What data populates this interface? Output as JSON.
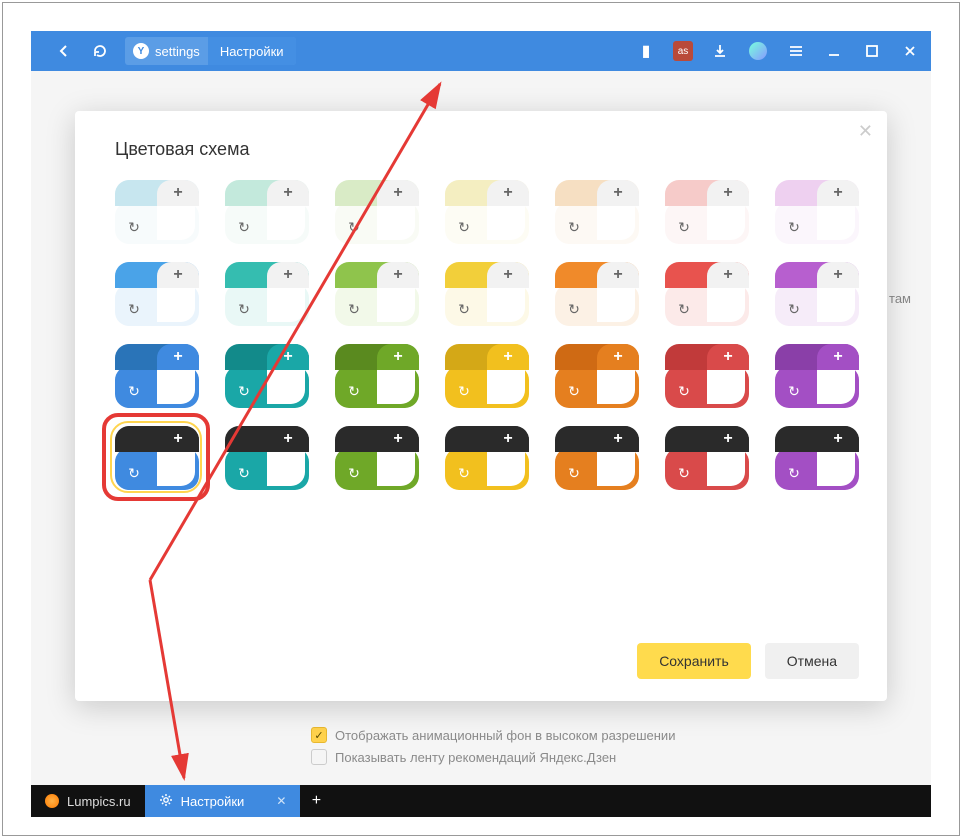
{
  "titlebar": {
    "addr_text": "settings",
    "page_title": "Настройки"
  },
  "modal": {
    "title": "Цветовая схема",
    "save_label": "Сохранить",
    "cancel_label": "Отмена"
  },
  "hidden": {
    "right_text": "там",
    "check1": "Отображать анимационный фон в высоком разрешении",
    "check2": "Показывать ленту рекомендаций Яндекс.Дзен"
  },
  "taskbar": {
    "item1": "Lumpics.ru",
    "item2": "Настройки"
  },
  "colors": {
    "row1": [
      {
        "top": "#c7e6ef",
        "tab": "#f2f2f2",
        "main": "#f7fbfc",
        "dark": false
      },
      {
        "top": "#c3e9dc",
        "tab": "#f2f2f2",
        "main": "#f6fbf9",
        "dark": false
      },
      {
        "top": "#d9ebc6",
        "tab": "#f2f2f2",
        "main": "#f9fbf5",
        "dark": false
      },
      {
        "top": "#f4eec1",
        "tab": "#f2f2f2",
        "main": "#fdfcf4",
        "dark": false
      },
      {
        "top": "#f6dfc2",
        "tab": "#f2f2f2",
        "main": "#fdf9f4",
        "dark": false
      },
      {
        "top": "#f6cbc9",
        "tab": "#f2f2f2",
        "main": "#fdf6f6",
        "dark": false
      },
      {
        "top": "#eed0f0",
        "tab": "#f2f2f2",
        "main": "#fbf6fc",
        "dark": false
      }
    ],
    "row2": [
      {
        "top": "#4aa3e8",
        "tab": "#f2f2f2",
        "main": "#eaf4fc",
        "dark": false
      },
      {
        "top": "#35bdb0",
        "tab": "#f2f2f2",
        "main": "#e9f8f6",
        "dark": false
      },
      {
        "top": "#8fc44c",
        "tab": "#f2f2f2",
        "main": "#f2f9e9",
        "dark": false
      },
      {
        "top": "#f2cf3a",
        "tab": "#f2f2f2",
        "main": "#fdf9e7",
        "dark": false
      },
      {
        "top": "#f08a2a",
        "tab": "#f2f2f2",
        "main": "#fcf1e5",
        "dark": false
      },
      {
        "top": "#e8534e",
        "tab": "#f2f2f2",
        "main": "#fceae9",
        "dark": false
      },
      {
        "top": "#b75fcf",
        "tab": "#f2f2f2",
        "main": "#f6ecf9",
        "dark": false
      }
    ],
    "row3": [
      {
        "top": "#2a74b8",
        "tab": "#3f8ae0",
        "main": "#3f8ae0",
        "dark": true
      },
      {
        "top": "#128a8a",
        "tab": "#1aa7a7",
        "main": "#1aa7a7",
        "dark": true
      },
      {
        "top": "#5a8a1f",
        "tab": "#6fa828",
        "main": "#6fa828",
        "dark": true
      },
      {
        "top": "#d4a817",
        "tab": "#f2c01e",
        "main": "#f2c01e",
        "dark": true
      },
      {
        "top": "#cf6a14",
        "tab": "#e57f1f",
        "main": "#e57f1f",
        "dark": true
      },
      {
        "top": "#c13a3a",
        "tab": "#d94a4a",
        "main": "#d94a4a",
        "dark": true
      },
      {
        "top": "#8a3fa8",
        "tab": "#a34fc4",
        "main": "#a34fc4",
        "dark": true
      }
    ],
    "row4": [
      {
        "top": "#2a2a2a",
        "tab": "#2a2a2a",
        "main": "#3f8ae0",
        "dark": true
      },
      {
        "top": "#2a2a2a",
        "tab": "#2a2a2a",
        "main": "#1aa7a7",
        "dark": true
      },
      {
        "top": "#2a2a2a",
        "tab": "#2a2a2a",
        "main": "#6fa828",
        "dark": true
      },
      {
        "top": "#2a2a2a",
        "tab": "#2a2a2a",
        "main": "#f2c01e",
        "dark": true
      },
      {
        "top": "#2a2a2a",
        "tab": "#2a2a2a",
        "main": "#e57f1f",
        "dark": true
      },
      {
        "top": "#2a2a2a",
        "tab": "#2a2a2a",
        "main": "#d94a4a",
        "dark": true
      },
      {
        "top": "#2a2a2a",
        "tab": "#2a2a2a",
        "main": "#a34fc4",
        "dark": true
      }
    ]
  }
}
